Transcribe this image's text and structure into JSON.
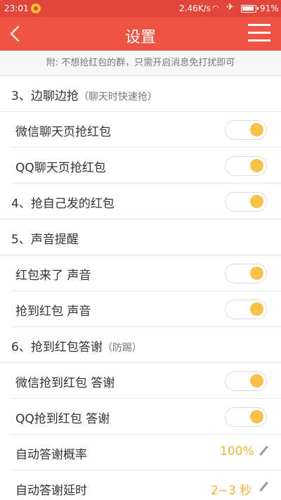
{
  "status_bar": {
    "time": "23:01",
    "net_speed": "2.46K/s",
    "battery_text": "91%",
    "battery_level": 0.91,
    "icons": [
      "notification-icon",
      "wifi-icon",
      "airplane-mode-icon",
      "battery-icon"
    ]
  },
  "header": {
    "title": "设置",
    "back_icon": "back-arrow-icon",
    "menu_icon": "menu-icon"
  },
  "hint": "附: 不想抢红包的群，只需开启消息免打扰即可",
  "colors": {
    "header_bg": "#ee5545",
    "status_bg": "#e2463a",
    "accent": "#f8c24a",
    "value_text": "#f0b33e"
  },
  "rows": [
    {
      "type": "section",
      "label": "3、边聊边抢",
      "sub": "（聊天时快速抢）",
      "toggle": false
    },
    {
      "type": "item",
      "label": "微信聊天页抢红包",
      "toggle": true,
      "on": true
    },
    {
      "type": "item",
      "label": "QQ聊天页抢红包",
      "toggle": true,
      "on": true
    },
    {
      "type": "section",
      "label": "4、抢自己发的红包",
      "toggle": true,
      "on": true
    },
    {
      "type": "section",
      "label": "5、声音提醒",
      "toggle": false
    },
    {
      "type": "item",
      "label": "红包来了 声音",
      "toggle": true,
      "on": true
    },
    {
      "type": "item",
      "label": "抢到红包 声音",
      "toggle": true,
      "on": true
    },
    {
      "type": "section",
      "label": "6、抢到红包答谢",
      "sub": "（防踢）",
      "toggle": false
    },
    {
      "type": "item",
      "label": "微信抢到红包 答谢",
      "toggle": true,
      "on": true
    },
    {
      "type": "item",
      "label": "QQ抢到红包 答谢",
      "toggle": true,
      "on": true
    },
    {
      "type": "item",
      "label": "自动答谢概率",
      "value": "100%",
      "editable": true
    },
    {
      "type": "item",
      "label": "自动答谢延时",
      "value": "2~3 秒",
      "editable": true
    }
  ]
}
